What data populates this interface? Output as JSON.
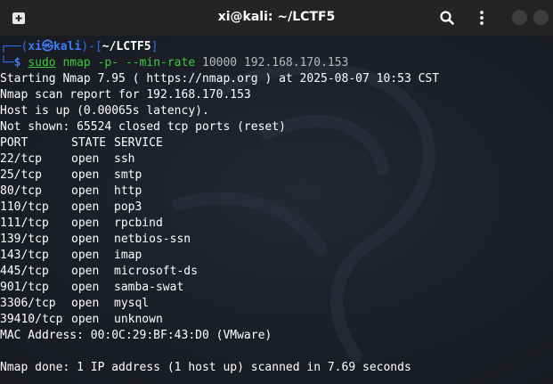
{
  "titlebar": {
    "title": "xi@kali: ~/LCTF5"
  },
  "prompt": {
    "open": "┌──(",
    "user": "xi",
    "at": "㉿",
    "host": "kali",
    "mid": ")-[",
    "path": "~/LCTF5",
    "close": "]",
    "arrow": "└─",
    "dollar": "$",
    "sudo": "sudo",
    "command": "nmap -p- --min-rate",
    "rate": "10000",
    "target": "192.168.170.153"
  },
  "output": {
    "start": "Starting Nmap 7.95 ( https://nmap.org ) at 2025-08-07 10:53 CST",
    "report": "Nmap scan report for 192.168.170.153",
    "host": "Host is up (0.00065s latency).",
    "notshown": "Not shown: 65524 closed tcp ports (reset)",
    "headers": [
      "PORT",
      "STATE",
      "SERVICE"
    ],
    "ports": [
      {
        "port": "22/tcp",
        "state": "open",
        "service": "ssh"
      },
      {
        "port": "25/tcp",
        "state": "open",
        "service": "smtp"
      },
      {
        "port": "80/tcp",
        "state": "open",
        "service": "http"
      },
      {
        "port": "110/tcp",
        "state": "open",
        "service": "pop3"
      },
      {
        "port": "111/tcp",
        "state": "open",
        "service": "rpcbind"
      },
      {
        "port": "139/tcp",
        "state": "open",
        "service": "netbios-ssn"
      },
      {
        "port": "143/tcp",
        "state": "open",
        "service": "imap"
      },
      {
        "port": "445/tcp",
        "state": "open",
        "service": "microsoft-ds"
      },
      {
        "port": "901/tcp",
        "state": "open",
        "service": "samba-swat"
      },
      {
        "port": "3306/tcp",
        "state": "open",
        "service": "mysql"
      },
      {
        "port": "39410/tcp",
        "state": "open",
        "service": "unknown"
      }
    ],
    "mac": "MAC Address: 00:0C:29:BF:43:D0 (VMware)",
    "done": "Nmap done: 1 IP address (1 host up) scanned in 7.69 seconds"
  },
  "icons": {
    "new_tab": "new-tab-icon",
    "search": "search-icon",
    "menu": "kebab-menu-icon",
    "minimize": "minimize-icon",
    "close": "close-icon"
  }
}
